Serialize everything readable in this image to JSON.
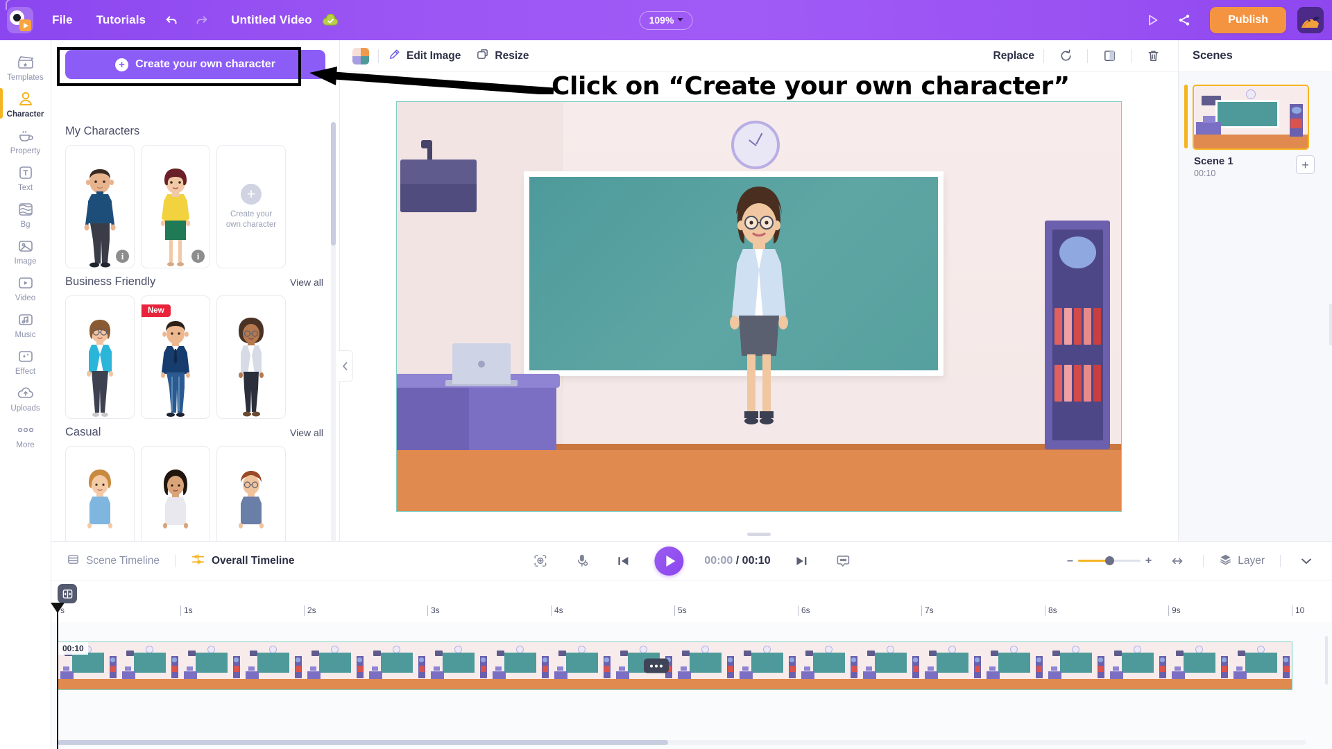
{
  "topbar": {
    "logo_name": "animaker-logo",
    "menus": [
      {
        "label": "File",
        "name": "menu-file"
      },
      {
        "label": "Tutorials",
        "name": "menu-tutorials"
      }
    ],
    "undo_icon": "undo-icon",
    "redo_icon": "redo-icon",
    "doc_title": "Untitled Video",
    "saved_icon": "cloud-saved-icon",
    "zoom_level": "109%",
    "preview_icon": "preview-play-icon",
    "share_icon": "share-icon",
    "publish_label": "Publish",
    "avatar_name": "user-avatar"
  },
  "rail": {
    "items": [
      {
        "label": "Templates",
        "icon": "templates-icon",
        "active": false
      },
      {
        "label": "Character",
        "icon": "character-icon",
        "active": true
      },
      {
        "label": "Property",
        "icon": "property-icon",
        "active": false
      },
      {
        "label": "Text",
        "icon": "text-icon",
        "active": false
      },
      {
        "label": "Bg",
        "icon": "background-icon",
        "active": false
      },
      {
        "label": "Image",
        "icon": "image-icon",
        "active": false
      },
      {
        "label": "Video",
        "icon": "video-icon",
        "active": false
      },
      {
        "label": "Music",
        "icon": "music-icon",
        "active": false
      },
      {
        "label": "Effect",
        "icon": "effect-icon",
        "active": false
      },
      {
        "label": "Uploads",
        "icon": "uploads-icon",
        "active": false
      },
      {
        "label": "More",
        "icon": "more-icon",
        "active": false
      }
    ]
  },
  "panel": {
    "create_button_label": "Create your own character",
    "collapse_icon": "chevron-left-icon",
    "sections": [
      {
        "title": "My Characters",
        "view_all": "",
        "cards": [
          {
            "type": "character",
            "name": "character-male-navy-top",
            "info": "i"
          },
          {
            "type": "character",
            "name": "character-female-yellow-top",
            "info": "i"
          },
          {
            "type": "create",
            "line1": "Create your",
            "line2": "own character"
          }
        ]
      },
      {
        "title": "Business Friendly",
        "view_all": "View all",
        "cards": [
          {
            "type": "character",
            "name": "character-female-teal-cardigan"
          },
          {
            "type": "character",
            "name": "character-male-blue-suit",
            "badge": "New"
          },
          {
            "type": "character",
            "name": "character-female-grey-cardigan"
          }
        ]
      },
      {
        "title": "Casual",
        "view_all": "View all",
        "cards": [
          {
            "type": "character",
            "name": "character-casual-1"
          },
          {
            "type": "character",
            "name": "character-casual-2"
          },
          {
            "type": "character",
            "name": "character-casual-3"
          }
        ]
      }
    ]
  },
  "canvas_toolbar": {
    "swatch_name": "color-swatch",
    "edit_image_label": "Edit Image",
    "edit_image_icon": "brush-icon",
    "resize_label": "Resize",
    "resize_icon": "resize-icon",
    "replace_label": "Replace",
    "rotate_icon": "rotate-icon",
    "flip_icon": "flip-icon",
    "delete_icon": "trash-icon"
  },
  "scenes": {
    "title": "Scenes",
    "items": [
      {
        "name": "Scene 1",
        "duration": "00:10",
        "active": true
      }
    ],
    "add_label": "+"
  },
  "timeline": {
    "scene_timeline_label": "Scene Timeline",
    "scene_timeline_icon": "scene-timeline-icon",
    "overall_timeline_label": "Overall Timeline",
    "overall_timeline_icon": "overall-timeline-icon",
    "fit_icon": "fit-to-screen-icon",
    "mic_icon": "microphone-add-icon",
    "prev_icon": "skip-previous-icon",
    "play_icon": "play-icon",
    "next_icon": "skip-next-icon",
    "caption_icon": "caption-icon",
    "current_time": "00:00",
    "separator": "/",
    "total_time": "00:10",
    "zoom_minus": "–",
    "zoom_plus": "+",
    "fit_width_icon": "fit-width-icon",
    "layer_label": "Layer",
    "layer_icon": "layers-icon",
    "collapse_icon": "chevron-down-icon",
    "snap_icon": "snap-icon",
    "ticks": [
      "s",
      "1s",
      "2s",
      "3s",
      "4s",
      "5s",
      "6s",
      "7s",
      "8s",
      "9s",
      "10"
    ],
    "clip_duration": "00:10",
    "clip_menu_icon": "clip-options-icon"
  },
  "annotation": {
    "text": "Click on “Create your own character”",
    "arrow_name": "annotation-arrow",
    "highlight_name": "highlight-box"
  },
  "colors": {
    "brand_purple": "#8b46ef",
    "accent_orange": "#f59440",
    "accent_yellow": "#f5b421",
    "badge_red": "#e8233b",
    "board_teal": "#4e9a9b",
    "floor_orange": "#e08a4f"
  }
}
